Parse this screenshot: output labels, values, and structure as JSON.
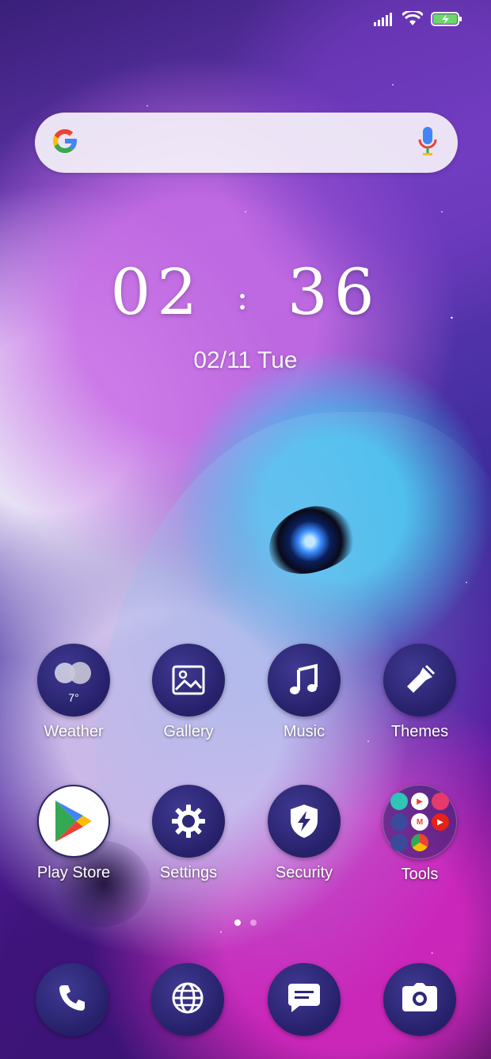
{
  "clock": {
    "hours": "02",
    "separator": ":",
    "minutes": "36"
  },
  "date": {
    "day": "02/11",
    "weekday": "Tue"
  },
  "apps": [
    {
      "label": "Weather",
      "temp": "7°"
    },
    {
      "label": "Gallery"
    },
    {
      "label": "Music"
    },
    {
      "label": "Themes"
    },
    {
      "label": "Play Store"
    },
    {
      "label": "Settings"
    },
    {
      "label": "Security"
    },
    {
      "label": "Tools"
    }
  ],
  "colors": {
    "icon_bg": "#26206a",
    "google_blue": "#4285F4",
    "google_red": "#EA4335",
    "google_yellow": "#FBBC05",
    "google_green": "#34A853",
    "battery_green": "#6bd66b"
  }
}
